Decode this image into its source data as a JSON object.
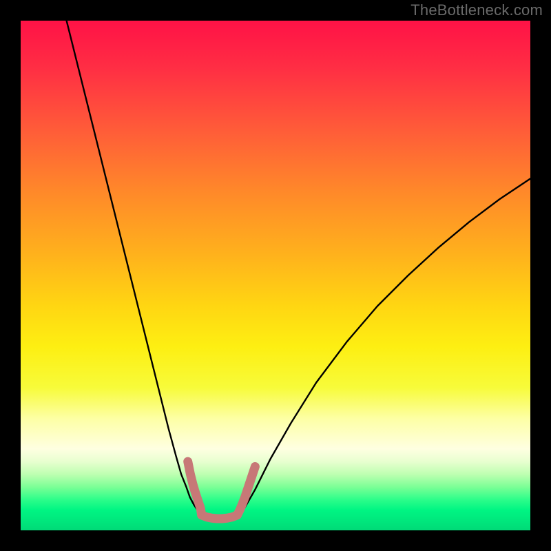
{
  "watermark": "TheBottleneck.com",
  "chart_data": {
    "type": "line",
    "title": "",
    "xlabel": "",
    "ylabel": "",
    "xlim": [
      0,
      100
    ],
    "ylim": [
      0,
      100
    ],
    "gradient_stops": [
      {
        "pos": 0,
        "color": "#ff1246"
      },
      {
        "pos": 22,
        "color": "#ff5e38"
      },
      {
        "pos": 46,
        "color": "#ffb21c"
      },
      {
        "pos": 64,
        "color": "#fdef12"
      },
      {
        "pos": 84,
        "color": "#feffe1"
      },
      {
        "pos": 92,
        "color": "#7bff96"
      },
      {
        "pos": 100,
        "color": "#00da77"
      }
    ],
    "series": [
      {
        "name": "left-curve",
        "x": [
          9.0,
          11.0,
          13.5,
          16.0,
          18.5,
          21.0,
          23.5,
          25.5,
          27.5,
          29.0,
          30.5,
          31.5,
          32.5,
          33.2,
          34.0,
          35.0,
          35.5
        ],
        "y": [
          100.0,
          92.0,
          82.0,
          72.0,
          62.0,
          52.0,
          42.0,
          34.0,
          26.0,
          20.0,
          14.5,
          11.0,
          8.5,
          6.5,
          5.0,
          3.5,
          2.5
        ]
      },
      {
        "name": "valley-floor",
        "x": [
          35.5,
          36.5,
          37.5,
          38.5,
          39.5,
          40.5,
          41.5,
          42.5
        ],
        "y": [
          2.5,
          2.2,
          2.1,
          2.0,
          2.0,
          2.1,
          2.3,
          2.7
        ]
      },
      {
        "name": "right-curve",
        "x": [
          42.5,
          44.0,
          46.0,
          49.0,
          53.0,
          58.0,
          64.0,
          70.0,
          76.0,
          82.0,
          88.0,
          94.0,
          100.0
        ],
        "y": [
          2.7,
          4.5,
          8.0,
          14.0,
          21.0,
          29.0,
          37.0,
          44.0,
          50.0,
          55.5,
          60.5,
          65.0,
          69.0
        ]
      },
      {
        "name": "pink-overlay-left",
        "stroke": "#c77877",
        "stroke_width": 13,
        "x": [
          32.8,
          33.3,
          33.8,
          34.3,
          34.8,
          35.3,
          35.5
        ],
        "y": [
          13.5,
          11.0,
          9.0,
          7.3,
          5.8,
          4.3,
          3.0
        ]
      },
      {
        "name": "pink-overlay-floor",
        "stroke": "#c77877",
        "stroke_width": 13,
        "x": [
          35.5,
          36.5,
          37.5,
          38.5,
          39.5,
          40.5,
          41.5,
          42.5
        ],
        "y": [
          3.0,
          2.6,
          2.4,
          2.3,
          2.3,
          2.4,
          2.6,
          3.0
        ]
      },
      {
        "name": "pink-overlay-right",
        "stroke": "#c77877",
        "stroke_width": 13,
        "x": [
          42.5,
          43.0,
          43.5,
          44.0,
          44.5,
          45.0,
          45.5,
          46.0
        ],
        "y": [
          3.0,
          4.0,
          5.2,
          6.5,
          8.0,
          9.5,
          11.0,
          12.5
        ]
      }
    ]
  }
}
